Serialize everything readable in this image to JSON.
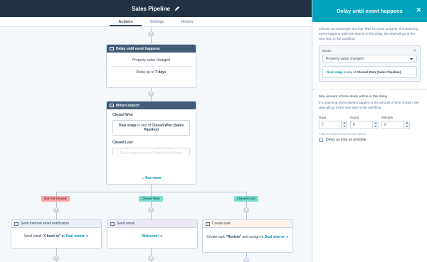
{
  "header": {
    "title": "Sales Pipeline"
  },
  "tabs": [
    {
      "label": "Actions"
    },
    {
      "label": "Settings"
    },
    {
      "label": "History"
    }
  ],
  "delay_card": {
    "title": "Delay until event happens",
    "row1": "Property value changed",
    "row2_prefix": "Delay up to",
    "row2_value": "7 days"
  },
  "branch_card": {
    "title": "If/then branch",
    "branch1_label": "Closed Won",
    "branch1_text_a": "Deal stage",
    "branch1_text_b": " is any of ",
    "branch1_text_c": "Closed Won (Sales Pipeline)",
    "branch2_label": "Closed Lost",
    "branch2_text": "Deal stage is any of Closed Lost (Sales",
    "see_more": "See more"
  },
  "branch_tags": {
    "not_yet": "Not Yet Closed",
    "won": "Closed Won",
    "lost": "Closed Lost"
  },
  "actions": {
    "email_notify": {
      "title": "Send internal email notification",
      "text_a": "Send email ",
      "text_b": "\"Check in\"",
      "text_c": " to ",
      "link": "Deal owner"
    },
    "send_email": {
      "title": "Send email",
      "link": "Welcome!"
    },
    "create_task": {
      "title": "Create task",
      "text_a": "Create task ",
      "text_b": "\"Review\"",
      "text_c": " and assign to ",
      "link": "Deal own-er"
    }
  },
  "panel": {
    "title": "Delay until event happens",
    "description": "Choose an event type and then filter by event property. If a matching event happens while the deal is in this delay, the deal will go to the next step in the workflow.",
    "event_label": "Event",
    "event_value": "Property value changed",
    "filter_a": "Deal stage",
    "filter_b": " is any of ",
    "filter_c": "Closed Won (Sales Pipeline)",
    "max_title": "Max amount of time deals will be in this delay",
    "max_desc": "If a matching event doesn't happen in the amount of time chosen, the deal will go to the next step in the workflow.",
    "days_label": "Days",
    "days_value": "7",
    "hours_label": "Hours",
    "hours_value": "0",
    "minutes_label": "Minutes",
    "minutes_value": "0",
    "hint": "1 day is equal to a full 24-hour period",
    "checkbox_label": "Delay as long as possible"
  },
  "colors": {
    "header_bg": "#213343",
    "panel_accent": "#00a4bd",
    "card_head": "#425b76",
    "link": "#0091ae"
  }
}
